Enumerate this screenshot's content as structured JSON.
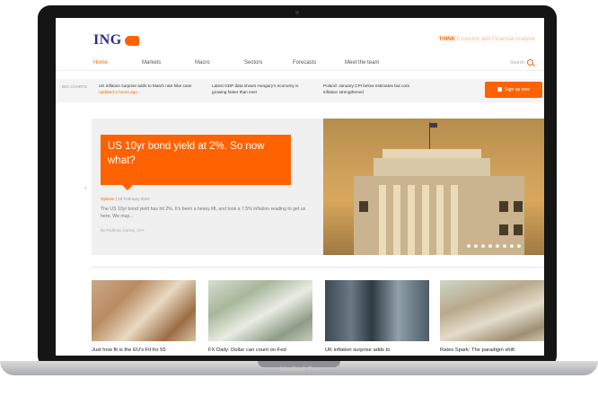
{
  "brand": {
    "name": "ING",
    "tagline_strong": "THINK",
    "tagline": "Economic and Financial Analysis"
  },
  "nav": {
    "items": [
      "Home",
      "Markets",
      "Macro",
      "Sectors",
      "Forecasts",
      "Meet the team"
    ],
    "search_label": "Search"
  },
  "ticker": {
    "section_label": "BIG CHARTS",
    "items": [
      {
        "text": "UK inflation surprise adds to March rate hike case",
        "updated": "updated 1 hours ago"
      },
      {
        "text": "Latest GDP data shows Hungary's economy is growing faster than ever",
        "updated": ""
      },
      {
        "text": "Poland: January CPI below estimates but core inflation strengthened",
        "updated": ""
      }
    ],
    "signup_label": "Sign up now"
  },
  "hero": {
    "title": "US 10yr bond yield at 2%. So now what?",
    "category": "Opinion",
    "date": "16 February 2022",
    "excerpt": "The US 10yr bond yield has hit 2%. It's been a heavy lift, and took a 7.5% inflation reading to get us here. We may...",
    "byline": "By Padhraic Garvey, CFA",
    "slide_count": 8
  },
  "cards": [
    {
      "title": "Just how fit is the EU's Fit for 55"
    },
    {
      "title": "FX Daily: Dollar can count on Fed"
    },
    {
      "title": "UK inflation surprise adds to"
    },
    {
      "title": "Rates Spark: The paradigm shift"
    }
  ],
  "device": {
    "label": "MacBook Pro"
  },
  "colors": {
    "accent": "#ff6200",
    "brand_blue": "#2b2b8c"
  }
}
